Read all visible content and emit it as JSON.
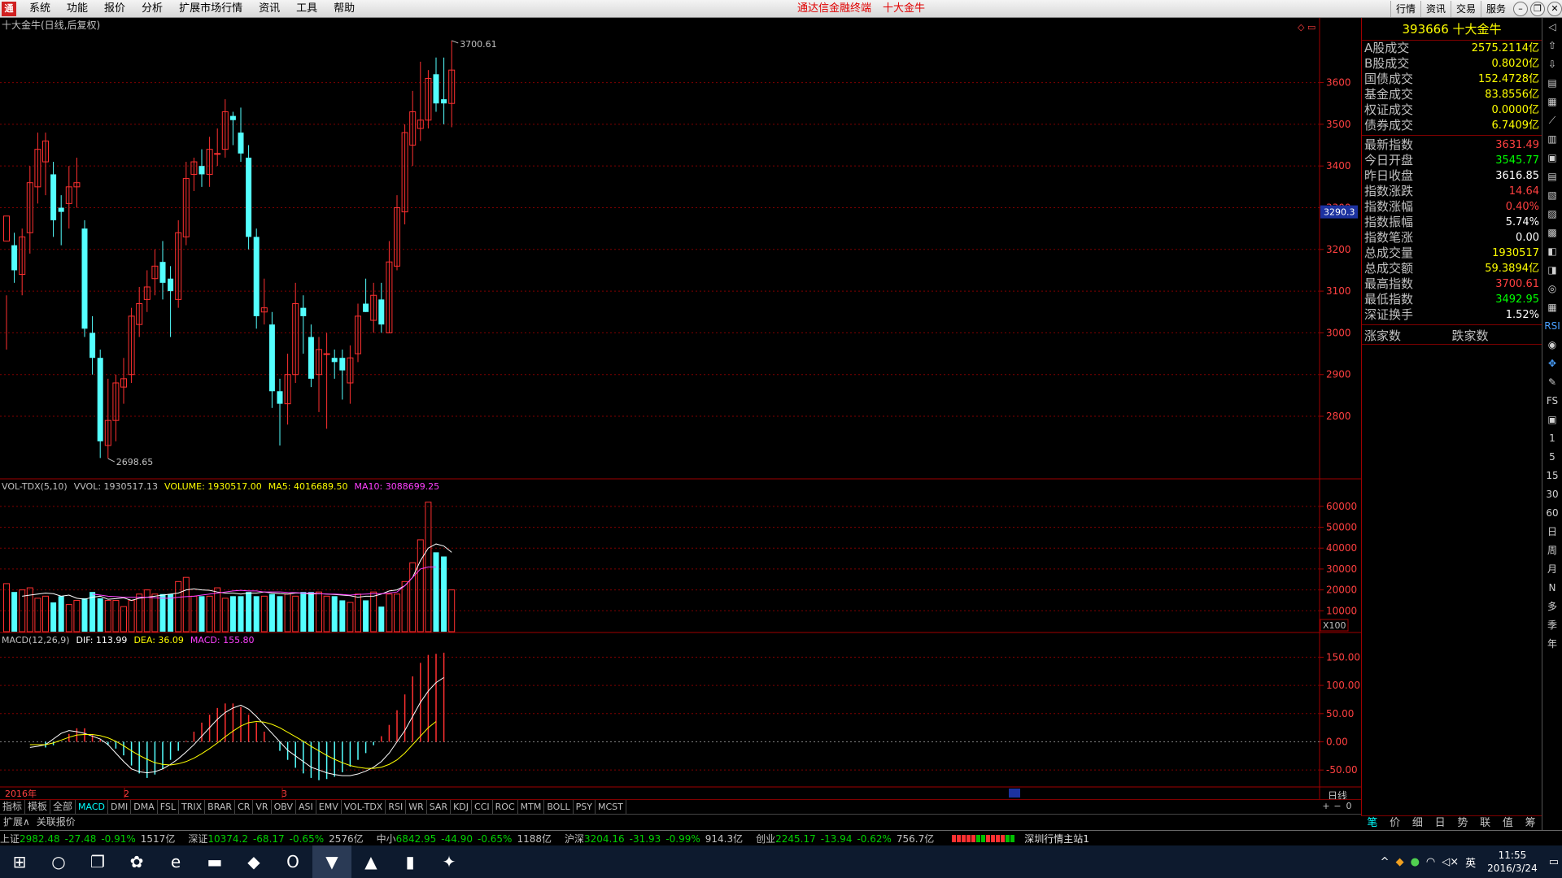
{
  "menubar": {
    "app_icon": "tdx-logo-icon",
    "items": [
      "系统",
      "功能",
      "报价",
      "分析",
      "扩展市场行情",
      "资讯",
      "工具",
      "帮助"
    ],
    "title_app": "通达信金融终端",
    "title_stock": "十大金牛",
    "right_buttons": [
      "行情",
      "资讯",
      "交易",
      "服务"
    ]
  },
  "chart": {
    "title": "十大金牛(日线,后复权)",
    "price_high_label": "3700.61",
    "price_low_label": "2698.65",
    "current_price_tag": "3290.3",
    "price_axis": [
      "3600",
      "3500",
      "3400",
      "3300",
      "3200",
      "3100",
      "3000",
      "2900",
      "2800"
    ],
    "vol_header": {
      "name": "VOL-TDX(5,10)",
      "vvol": "VVOL: 1930517.13",
      "volume": "VOLUME: 1930517.00",
      "ma5": "MA5: 4016689.50",
      "ma10": "MA10: 3088699.25"
    },
    "vol_axis": [
      "60000",
      "50000",
      "40000",
      "30000",
      "20000",
      "10000"
    ],
    "vol_unit": "X100",
    "macd_header": {
      "name": "MACD(12,26,9)",
      "dif": "DIF: 113.99",
      "dea": "DEA: 36.09",
      "macd": "MACD: 155.80"
    },
    "macd_axis": [
      "150.00",
      "100.00",
      "50.00",
      "0.00",
      "-50.00"
    ],
    "date_labels": {
      "year": "2016年",
      "m2": "2",
      "m3": "3"
    },
    "period": "日线",
    "colors": {
      "up": "#ff3030",
      "down": "#54ffff",
      "ma5": "#ffffff",
      "ma10": "#ff40ff",
      "dea": "#ffff00",
      "grid": "#800000"
    },
    "candles": [
      [
        3220,
        3280,
        3090,
        2960
      ],
      [
        3210,
        3150,
        3240,
        3120
      ],
      [
        3140,
        3230,
        3250,
        3090
      ],
      [
        3240,
        3360,
        3400,
        3190
      ],
      [
        3350,
        3440,
        3480,
        3310
      ],
      [
        3410,
        3460,
        3480,
        3330
      ],
      [
        3380,
        3270,
        3410,
        3230
      ],
      [
        3300,
        3290,
        3330,
        3210
      ],
      [
        3310,
        3350,
        3400,
        3250
      ],
      [
        3350,
        3360,
        3420,
        3300
      ],
      [
        3250,
        3010,
        3270,
        2990
      ],
      [
        3000,
        2940,
        3040,
        2900
      ],
      [
        2940,
        2740,
        2960,
        2700
      ],
      [
        2730,
        2790,
        2890,
        2699
      ],
      [
        2790,
        2880,
        2900,
        2740
      ],
      [
        2870,
        2890,
        2940,
        2830
      ],
      [
        2900,
        3040,
        3060,
        2880
      ],
      [
        3020,
        3070,
        3110,
        2990
      ],
      [
        3080,
        3110,
        3150,
        3050
      ],
      [
        3130,
        3160,
        3200,
        3090
      ],
      [
        3170,
        3120,
        3220,
        3080
      ],
      [
        3130,
        3100,
        3160,
        2990
      ],
      [
        3080,
        3240,
        3270,
        3060
      ],
      [
        3230,
        3370,
        3410,
        3210
      ],
      [
        3380,
        3410,
        3420,
        3340
      ],
      [
        3400,
        3380,
        3440,
        3350
      ],
      [
        3380,
        3440,
        3470,
        3350
      ],
      [
        3430,
        3430,
        3490,
        3400
      ],
      [
        3440,
        3530,
        3560,
        3420
      ],
      [
        3520,
        3510,
        3530,
        3450
      ],
      [
        3480,
        3430,
        3540,
        3410
      ],
      [
        3420,
        3230,
        3450,
        3200
      ],
      [
        3230,
        3040,
        3250,
        3010
      ],
      [
        3050,
        3060,
        3130,
        3020
      ],
      [
        3020,
        2860,
        3050,
        2820
      ],
      [
        2860,
        2830,
        2890,
        2730
      ],
      [
        2830,
        2900,
        2950,
        2780
      ],
      [
        2900,
        3070,
        3120,
        2880
      ],
      [
        3060,
        3040,
        3090,
        2950
      ],
      [
        2990,
        2890,
        3020,
        2870
      ],
      [
        2900,
        2960,
        2990,
        2810
      ],
      [
        2950,
        2950,
        3000,
        2770
      ],
      [
        2940,
        2930,
        2960,
        2890
      ],
      [
        2940,
        2910,
        2960,
        2840
      ],
      [
        2880,
        2940,
        2970,
        2830
      ],
      [
        2950,
        3040,
        3070,
        2930
      ],
      [
        3070,
        3050,
        3130,
        3050
      ],
      [
        3030,
        3090,
        3120,
        3000
      ],
      [
        3080,
        3020,
        3120,
        3000
      ],
      [
        3000,
        3170,
        3220,
        3000
      ],
      [
        3160,
        3300,
        3330,
        3150
      ],
      [
        3290,
        3480,
        3500,
        3260
      ],
      [
        3450,
        3530,
        3580,
        3400
      ],
      [
        3490,
        3510,
        3650,
        3460
      ],
      [
        3510,
        3610,
        3630,
        3490
      ],
      [
        3620,
        3550,
        3660,
        3530
      ],
      [
        3560,
        3550,
        3660,
        3500
      ],
      [
        3550,
        3630,
        3700.61,
        3493
      ]
    ],
    "volumes": [
      23000,
      19000,
      20000,
      21000,
      16000,
      17000,
      14000,
      17000,
      13000,
      15000,
      16000,
      19000,
      16000,
      15000,
      15000,
      12000,
      15000,
      18000,
      20000,
      18000,
      18000,
      18000,
      24000,
      26000,
      17000,
      17000,
      17000,
      21000,
      16000,
      17000,
      17000,
      19000,
      17000,
      17000,
      18000,
      17000,
      18000,
      17000,
      19000,
      19000,
      19000,
      17000,
      17000,
      15000,
      14000,
      18000,
      15000,
      19000,
      12000,
      18000,
      18000,
      24000,
      33000,
      44000,
      62000,
      38000,
      36000,
      20000
    ],
    "ma5": [
      17000,
      17500,
      18000,
      18500,
      18200,
      17000,
      17500,
      16000,
      15500,
      16500,
      17000,
      15500,
      15800,
      16200,
      15000,
      16000,
      16500,
      17000,
      17500,
      18000,
      18500,
      20000,
      20500,
      20000,
      19800,
      19000,
      18500,
      18500,
      18000,
      18500,
      18500,
      19000,
      18500,
      18200,
      18000,
      18500,
      18500,
      18000,
      18200,
      18000,
      17800,
      17500,
      17200,
      16500,
      17000,
      17000,
      18000,
      19500,
      20000,
      22000,
      26000,
      34000,
      40000,
      42000,
      41000,
      38000
    ],
    "ma10": [
      18000,
      17500,
      17000,
      16800,
      16500,
      16500,
      16500,
      16500,
      16200,
      16000,
      16000,
      16500,
      16800,
      17000,
      17500,
      18000,
      18500,
      19000,
      19500,
      19800,
      19500,
      19500,
      19000,
      19000,
      19000,
      18800,
      18700,
      18500,
      18500,
      18200,
      18000,
      18000,
      17800,
      17500,
      17800,
      18000,
      18200,
      18200,
      18500,
      19000,
      22000,
      26000,
      30000,
      31000,
      31000
    ],
    "macd_dif": [
      -10,
      -8,
      -5,
      5,
      15,
      20,
      18,
      15,
      10,
      5,
      -5,
      -20,
      -35,
      -48,
      -53,
      -55,
      -53,
      -48,
      -40,
      -30,
      -18,
      -5,
      10,
      25,
      40,
      52,
      60,
      65,
      58,
      45,
      30,
      15,
      0,
      -15,
      -25,
      -35,
      -45,
      -50,
      -55,
      -58,
      -60,
      -60,
      -57,
      -52,
      -45,
      -35,
      -20,
      0,
      20,
      45,
      70,
      90,
      105,
      114
    ],
    "macd_dea": [
      -5,
      -5,
      -5,
      -2,
      3,
      8,
      12,
      13,
      13,
      11,
      7,
      1,
      -7,
      -16,
      -24,
      -31,
      -37,
      -40,
      -41,
      -39,
      -35,
      -29,
      -21,
      -12,
      -2,
      9,
      19,
      28,
      34,
      36,
      35,
      31,
      25,
      17,
      9,
      1,
      -8,
      -16,
      -24,
      -31,
      -37,
      -42,
      -45,
      -47,
      -47,
      -45,
      -40,
      -32,
      -20,
      -5,
      10,
      25,
      36
    ],
    "macd_bar": [
      -10,
      -6,
      0,
      14,
      24,
      24,
      12,
      4,
      -6,
      -12,
      -24,
      -42,
      -56,
      -64,
      -58,
      -48,
      -32,
      -16,
      2,
      18,
      34,
      48,
      60,
      68,
      68,
      62,
      48,
      34,
      18,
      0,
      -16,
      -32,
      -46,
      -56,
      -64,
      -68,
      -66,
      -62,
      -54,
      -44,
      -32,
      -20,
      -6,
      10,
      30,
      56,
      84,
      116,
      140,
      154,
      156,
      158
    ]
  },
  "side": {
    "title": "393666 十大金牛",
    "rows1": [
      {
        "label": "A股成交",
        "value": "2575.2114亿",
        "color": "#ffff00"
      },
      {
        "label": "B股成交",
        "value": "0.8020亿",
        "color": "#ffff00"
      },
      {
        "label": "国债成交",
        "value": "152.4728亿",
        "color": "#ffff00"
      },
      {
        "label": "基金成交",
        "value": "83.8556亿",
        "color": "#ffff00"
      },
      {
        "label": "权证成交",
        "value": "0.0000亿",
        "color": "#ffff00"
      },
      {
        "label": "债券成交",
        "value": "6.7409亿",
        "color": "#ffff00"
      }
    ],
    "rows2": [
      {
        "label": "最新指数",
        "value": "3631.49",
        "color": "#ff4040"
      },
      {
        "label": "今日开盘",
        "value": "3545.77",
        "color": "#00ff00"
      },
      {
        "label": "昨日收盘",
        "value": "3616.85",
        "color": "#ffffff"
      },
      {
        "label": "指数涨跌",
        "value": "14.64",
        "color": "#ff4040"
      },
      {
        "label": "指数涨幅",
        "value": "0.40%",
        "color": "#ff4040"
      },
      {
        "label": "指数振幅",
        "value": "5.74%",
        "color": "#ffffff"
      },
      {
        "label": "指数笔涨",
        "value": "0.00",
        "color": "#ffffff"
      },
      {
        "label": "总成交量",
        "value": "1930517",
        "color": "#ffff00"
      },
      {
        "label": "总成交额",
        "value": "59.3894亿",
        "color": "#ffff00"
      },
      {
        "label": "最高指数",
        "value": "3700.61",
        "color": "#ff4040"
      },
      {
        "label": "最低指数",
        "value": "3492.95",
        "color": "#00ff00"
      },
      {
        "label": "深证换手",
        "value": "1.52%",
        "color": "#ffffff"
      }
    ],
    "rise_label": "涨家数",
    "fall_label": "跌家数",
    "tabs": [
      "笔",
      "价",
      "细",
      "日",
      "势",
      "联",
      "值",
      "筹"
    ]
  },
  "icon_column": [
    "◁",
    "⇧",
    "⇩",
    "▤",
    "▦",
    "⟋",
    "▥",
    "▣",
    "▤",
    "▧",
    "▨",
    "▩",
    "◧",
    "◨",
    "◎",
    "▦",
    "RSI",
    "◉",
    "✥",
    "✎",
    "FS",
    "▣",
    "1",
    "5",
    "15",
    "30",
    "60",
    "日",
    "周",
    "月",
    "N",
    "多",
    "季",
    "年"
  ],
  "tabbar": [
    "指标",
    "模板",
    "全部",
    "MACD",
    "DMI",
    "DMA",
    "FSL",
    "TRIX",
    "BRAR",
    "CR",
    "VR",
    "OBV",
    "ASI",
    "EMV",
    "VOL-TDX",
    "RSI",
    "WR",
    "SAR",
    "KDJ",
    "CCI",
    "ROC",
    "MTM",
    "BOLL",
    "PSY",
    "MCST"
  ],
  "zoom_ctrl": [
    "+",
    "−",
    "0"
  ],
  "subbar": [
    "扩展∧",
    "关联报价"
  ],
  "status": [
    {
      "name": "上证",
      "vals": [
        {
          "t": "2982.48",
          "c": "st-green"
        },
        {
          "t": "-27.48",
          "c": "st-green"
        },
        {
          "t": "-0.91%",
          "c": "st-green"
        },
        {
          "t": "1517亿",
          "c": "st-name"
        }
      ]
    },
    {
      "name": "深证",
      "vals": [
        {
          "t": "10374.2",
          "c": "st-green"
        },
        {
          "t": "-68.17",
          "c": "st-green"
        },
        {
          "t": "-0.65%",
          "c": "st-green"
        },
        {
          "t": "2576亿",
          "c": "st-name"
        }
      ]
    },
    {
      "name": "中小",
      "vals": [
        {
          "t": "6842.95",
          "c": "st-green"
        },
        {
          "t": "-44.90",
          "c": "st-green"
        },
        {
          "t": "-0.65%",
          "c": "st-green"
        },
        {
          "t": "1188亿",
          "c": "st-name"
        }
      ]
    },
    {
      "name": "沪深",
      "vals": [
        {
          "t": "3204.16",
          "c": "st-green"
        },
        {
          "t": "-31.93",
          "c": "st-green"
        },
        {
          "t": "-0.99%",
          "c": "st-green"
        },
        {
          "t": "914.3亿",
          "c": "st-name"
        }
      ]
    },
    {
      "name": "创业",
      "vals": [
        {
          "t": "2245.17",
          "c": "st-green"
        },
        {
          "t": "-13.94",
          "c": "st-green"
        },
        {
          "t": "-0.62%",
          "c": "st-green"
        },
        {
          "t": "756.7亿",
          "c": "st-name"
        }
      ]
    }
  ],
  "status_msg": "深圳行情主站1",
  "taskbar": {
    "items": [
      {
        "name": "windows-start-icon",
        "glyph": "⊞"
      },
      {
        "name": "search-circle-icon",
        "glyph": "○"
      },
      {
        "name": "task-view-icon",
        "glyph": "❐"
      },
      {
        "name": "app-pinwheel-icon",
        "glyph": "✿"
      },
      {
        "name": "edge-browser-icon",
        "glyph": "e"
      },
      {
        "name": "file-explorer-icon",
        "glyph": "▬"
      },
      {
        "name": "app-red-icon",
        "glyph": "◆"
      },
      {
        "name": "outlook-icon",
        "glyph": "O"
      },
      {
        "name": "tdx-app-icon",
        "glyph": "▼"
      },
      {
        "name": "app-stock-icon",
        "glyph": "▲"
      },
      {
        "name": "notes-app-icon",
        "glyph": "▮"
      },
      {
        "name": "app-game-icon",
        "glyph": "✦"
      }
    ],
    "tray_ime": "英",
    "time": "11:55",
    "date": "2016/3/24"
  }
}
